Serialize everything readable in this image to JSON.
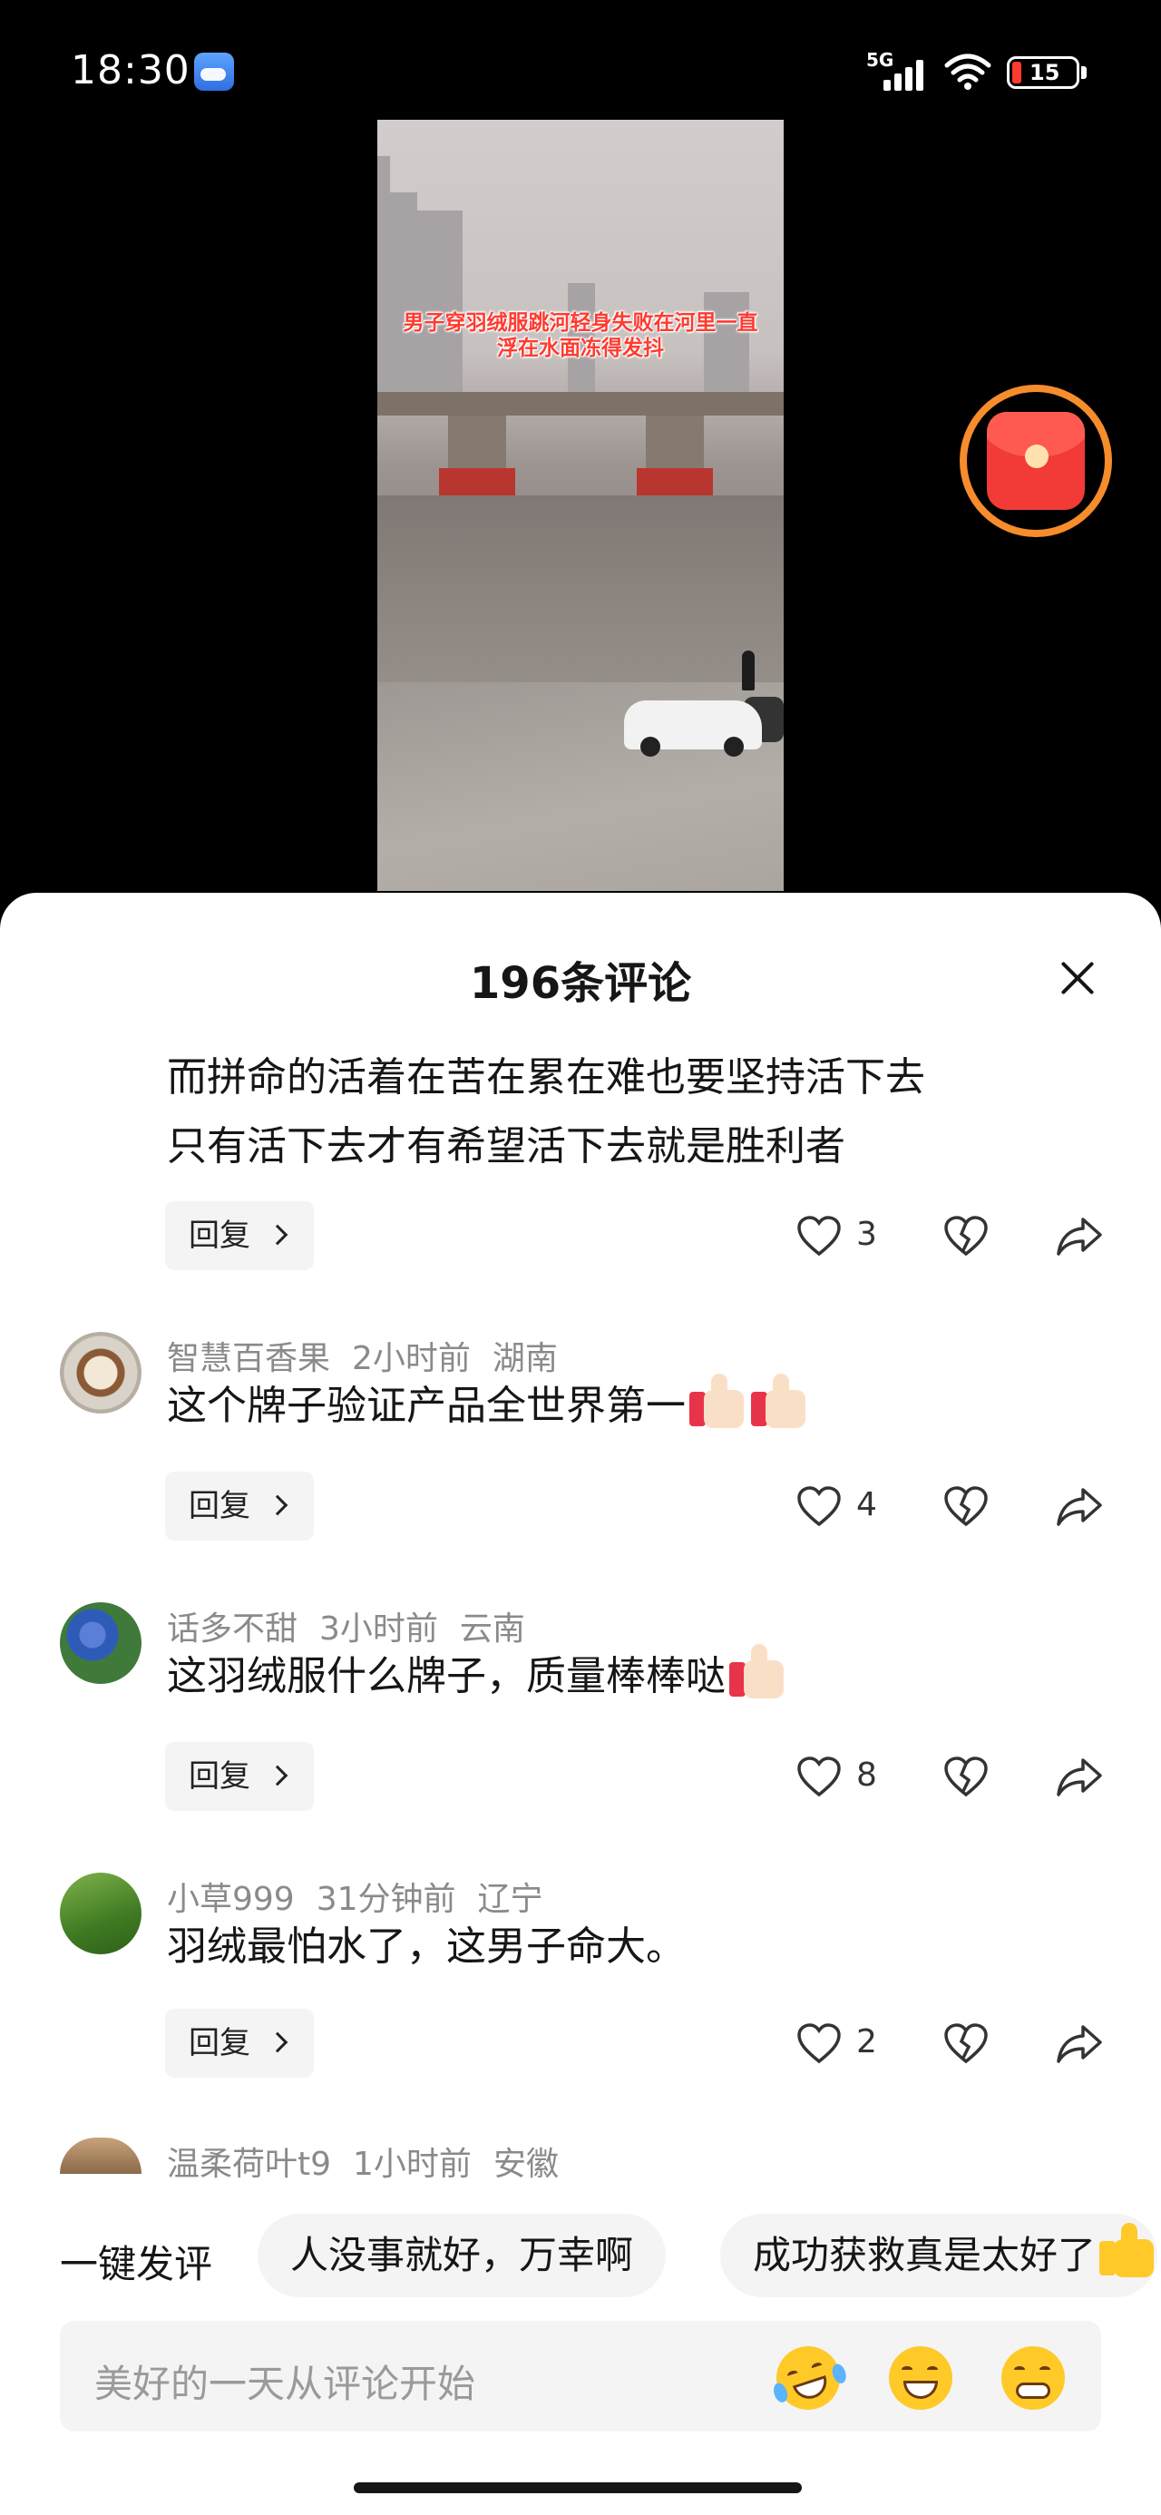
{
  "status_bar": {
    "time": "18:30",
    "network": "5G",
    "battery": "15"
  },
  "video": {
    "caption": "男子穿羽绒服跳河轻身失败在河里一直浮在水面冻得发抖"
  },
  "comments_sheet": {
    "title": "196条评论",
    "reply_label": "回复",
    "comments": [
      {
        "text_lines": [
          "而拼命的活着在苦在累在难也要坚持活下去",
          "只有活下去才有希望活下去就是胜利者"
        ],
        "likes": "3"
      },
      {
        "username": "智慧百香果",
        "time": "2小时前",
        "location": "湖南",
        "text": "这个牌子验证产品全世界第一",
        "emoji": "thumbs-up-emoji",
        "likes": "4"
      },
      {
        "username": "话多不甜",
        "time": "3小时前",
        "location": "云南",
        "text": "这羽绒服什么牌子，质量棒棒哒",
        "emoji": "thumbs-up-emoji",
        "likes": "8"
      },
      {
        "username": "小草999",
        "time": "31分钟前",
        "location": "辽宁",
        "text": "羽绒最怕水了，这男子命大。",
        "likes": "2"
      },
      {
        "username": "温柔荷叶t9",
        "time": "1小时前",
        "location": "安徽"
      }
    ]
  },
  "quick_reply": {
    "label": "一键发评",
    "chips": [
      "人没事就好，万幸啊",
      "成功获救真是太好了"
    ]
  },
  "input": {
    "placeholder": "美好的一天从评论开始"
  },
  "icons": {
    "like": "heart-icon",
    "dislike": "broken-heart-icon",
    "share": "share-arrow-icon",
    "close": "close-icon",
    "red_packet": "red-packet-icon",
    "emoji_buttons": [
      "laughing-tears-emoji",
      "grinning-emoji",
      "grin-emoji"
    ]
  },
  "colors": {
    "red_packet_ring": "#f78c2c",
    "red_packet": "#f23b37",
    "caption_text": "#ff3b30"
  }
}
